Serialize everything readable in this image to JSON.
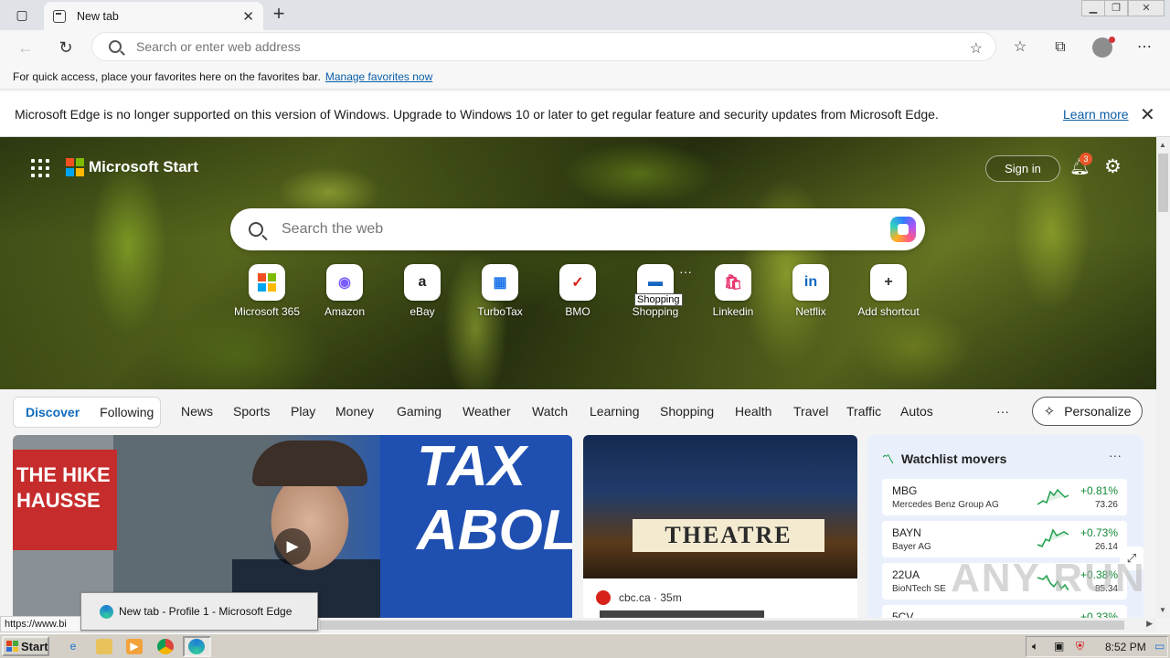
{
  "browser": {
    "tab_title": "New tab",
    "new_tab_symbol": "+",
    "address_placeholder": "Search or enter web address",
    "favorites_bar_text": "For quick access, place your favorites here on the favorites bar.",
    "favorites_bar_link": "Manage favorites now",
    "infobar_text": "Microsoft Edge is no longer supported on this version of Windows. Upgrade to Windows 10 or later to get regular feature and security updates from Microsoft Edge.",
    "infobar_link": "Learn more",
    "status_url": "https://www.bi",
    "icons": [
      "tab-actions-icon",
      "back-icon",
      "refresh-icon",
      "search-icon",
      "add-favorite-icon",
      "favorites-icon",
      "collections-icon",
      "profile-avatar",
      "more-icon"
    ]
  },
  "start_page": {
    "brand": "Microsoft Start",
    "sign_in": "Sign in",
    "notification_count": "3",
    "search_placeholder": "Search the web",
    "shortcuts": [
      {
        "label": "Microsoft 365",
        "icon": "ms365-icon",
        "glyph": "",
        "color": "#e74c3c"
      },
      {
        "label": "Amazon",
        "icon": "copilot-app-icon",
        "glyph": "◉",
        "color": "#7b5cff"
      },
      {
        "label": "eBay",
        "icon": "amazon-icon",
        "glyph": "a",
        "color": "#222222"
      },
      {
        "label": "TurboTax",
        "icon": "shopping-bag-icon",
        "glyph": "▦",
        "color": "#1a73e8"
      },
      {
        "label": "BMO",
        "icon": "check-icon",
        "glyph": "✓",
        "color": "#d6221a"
      },
      {
        "label": "Shopping",
        "icon": "bmo-icon",
        "glyph": "▬",
        "color": "#1565c0"
      },
      {
        "label": "Linkedin",
        "icon": "shopping-icon",
        "glyph": "🛍",
        "color": "#e8336d"
      },
      {
        "label": "Netflix",
        "icon": "linkedin-icon",
        "glyph": "in",
        "color": "#0a66c2"
      },
      {
        "label": "Add shortcut",
        "icon": "plus-icon",
        "glyph": "+",
        "color": "#333333"
      }
    ],
    "tooltip": "Shopping",
    "feed_tabs": {
      "active": "Discover",
      "other": "Following"
    },
    "nav": [
      "News",
      "Sports",
      "Play",
      "Money",
      "Gaming",
      "Weather",
      "Watch",
      "Learning",
      "Shopping",
      "Health",
      "Travel",
      "Traffic",
      "Autos"
    ],
    "more": "···",
    "personalize": "Personalize"
  },
  "video_card": {
    "sign_left": "THE HIKE\nHAUSSE",
    "sign_right": "TAX\nABOLI"
  },
  "news_card": {
    "marquee": "THEATRE",
    "source": "cbc.ca · 35m"
  },
  "watchlist": {
    "title": "Watchlist movers",
    "more": "···",
    "rows": [
      {
        "symbol": "MBG",
        "name": "Mercedes Benz Group AG",
        "change": "+0.81%",
        "price": "73.26"
      },
      {
        "symbol": "BAYN",
        "name": "Bayer AG",
        "change": "+0.73%",
        "price": "26.14"
      },
      {
        "symbol": "22UA",
        "name": "BioNTech SE",
        "change": "+0.38%",
        "price": "85.34"
      },
      {
        "symbol": "5CV",
        "name": "",
        "change": "+0.33%",
        "price": ""
      }
    ]
  },
  "watermark": "ANY RUN",
  "taskbar": {
    "start": "Start",
    "window_preview": "New tab - Profile 1 - Microsoft Edge",
    "clock": "8:52 PM"
  }
}
